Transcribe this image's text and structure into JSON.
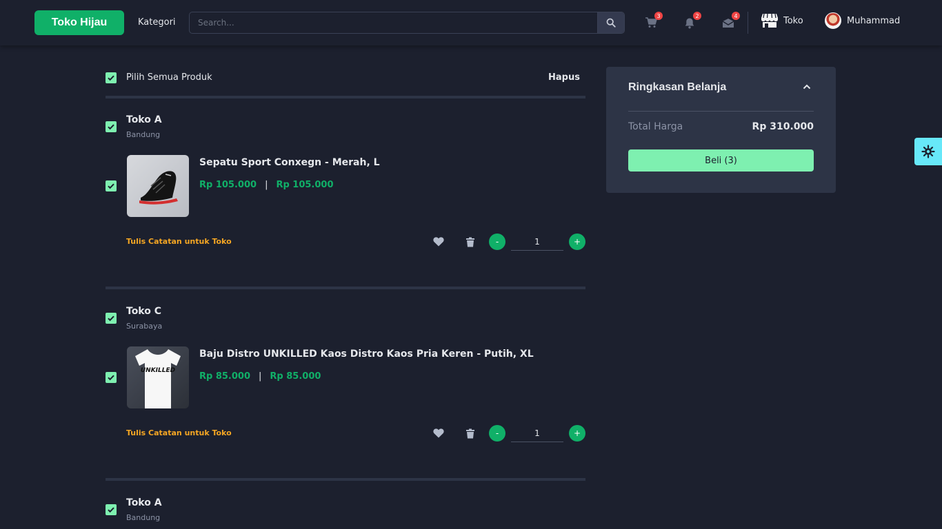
{
  "navbar": {
    "brand": "Toko Hijau",
    "kategori": "Kategori",
    "search_placeholder": "Search...",
    "cart_count": "3",
    "notif_count": "2",
    "mail_count": "4",
    "toko_label": "Toko",
    "user_name": "Muhammad"
  },
  "cart": {
    "select_all_label": "Pilih Semua Produk",
    "delete_label": "Hapus",
    "note_label": "Tulis Catatan untuk Toko",
    "stores": [
      {
        "name": "Toko A",
        "city": "Bandung",
        "product": {
          "name": "Sepatu Sport Conxegn - Merah, L",
          "price": "Rp 105.000",
          "price_total": "Rp 105.000",
          "qty": "1"
        }
      },
      {
        "name": "Toko C",
        "city": "Surabaya",
        "product": {
          "name": "Baju Distro UNKILLED Kaos Distro Kaos Pria Keren - Putih, XL",
          "price": "Rp 85.000",
          "price_total": "Rp 85.000",
          "qty": "1"
        }
      },
      {
        "name": "Toko A",
        "city": "Bandung"
      }
    ]
  },
  "summary": {
    "title": "Ringkasan Belanja",
    "total_label": "Total Harga",
    "total_value": "Rp 310.000",
    "buy_label": "Beli (3)"
  },
  "shirt_print": "UNKILLED",
  "colors": {
    "accent": "#10b068",
    "checkbox": "#7ef0b0",
    "note": "#f5a623",
    "background": "#1c202e",
    "panel": "#2d3446"
  }
}
